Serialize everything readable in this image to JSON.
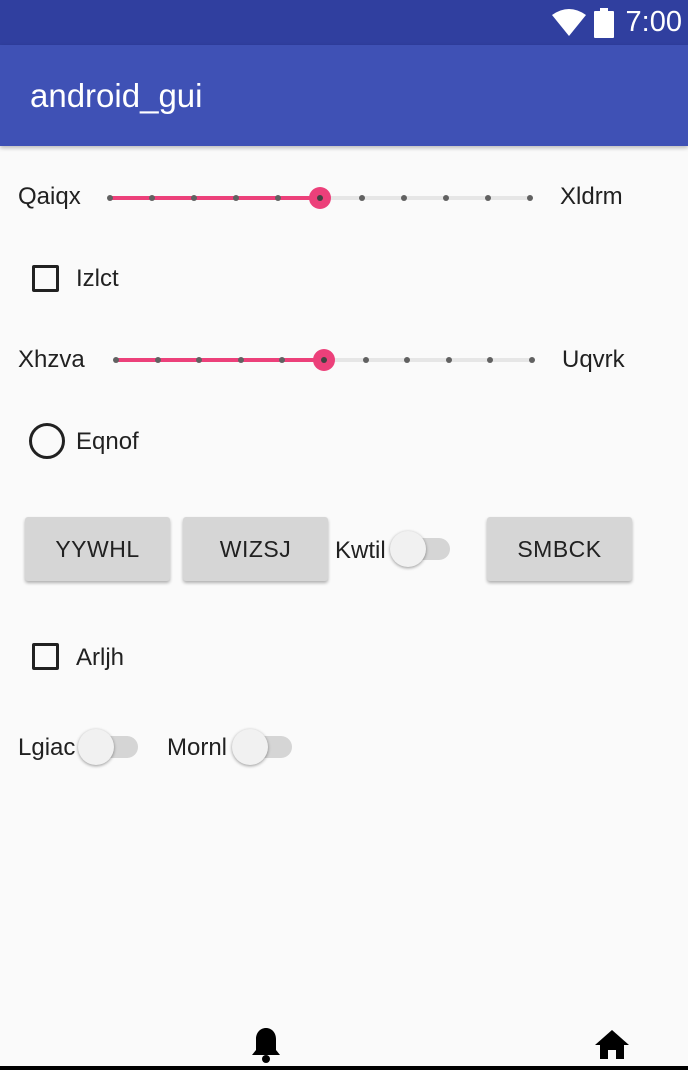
{
  "status_bar": {
    "time": "7:00",
    "icons": [
      "wifi-icon",
      "battery-icon"
    ]
  },
  "app_bar": {
    "title": "android_gui"
  },
  "content": {
    "seekbar1": {
      "label_left": "Qaiqx",
      "label_right": "Xldrm",
      "value": 5,
      "max": 10
    },
    "checkbox1": {
      "label": "Izlct",
      "checked": false
    },
    "seekbar2": {
      "label_left": "Xhzva",
      "label_right": "Uqvrk",
      "value": 5,
      "max": 10
    },
    "radio1": {
      "label": "Eqnof",
      "checked": false
    },
    "buttons": {
      "b1": "YYWHL",
      "b2": "WIZSJ",
      "b3": "SMBCK"
    },
    "switch_kwtil": {
      "label": "Kwtil",
      "on": false
    },
    "checkbox2": {
      "label": "Arljh",
      "checked": false
    },
    "switch_lgiac": {
      "label": "Lgiac",
      "on": false
    },
    "switch_mornl": {
      "label": "Mornl",
      "on": false
    }
  },
  "nav_bar": {
    "icons": [
      "notification-bell-icon",
      "home-icon"
    ]
  },
  "colors": {
    "status_bar": "#303f9f",
    "app_bar": "#3f51b5",
    "accent": "#ec407a"
  }
}
